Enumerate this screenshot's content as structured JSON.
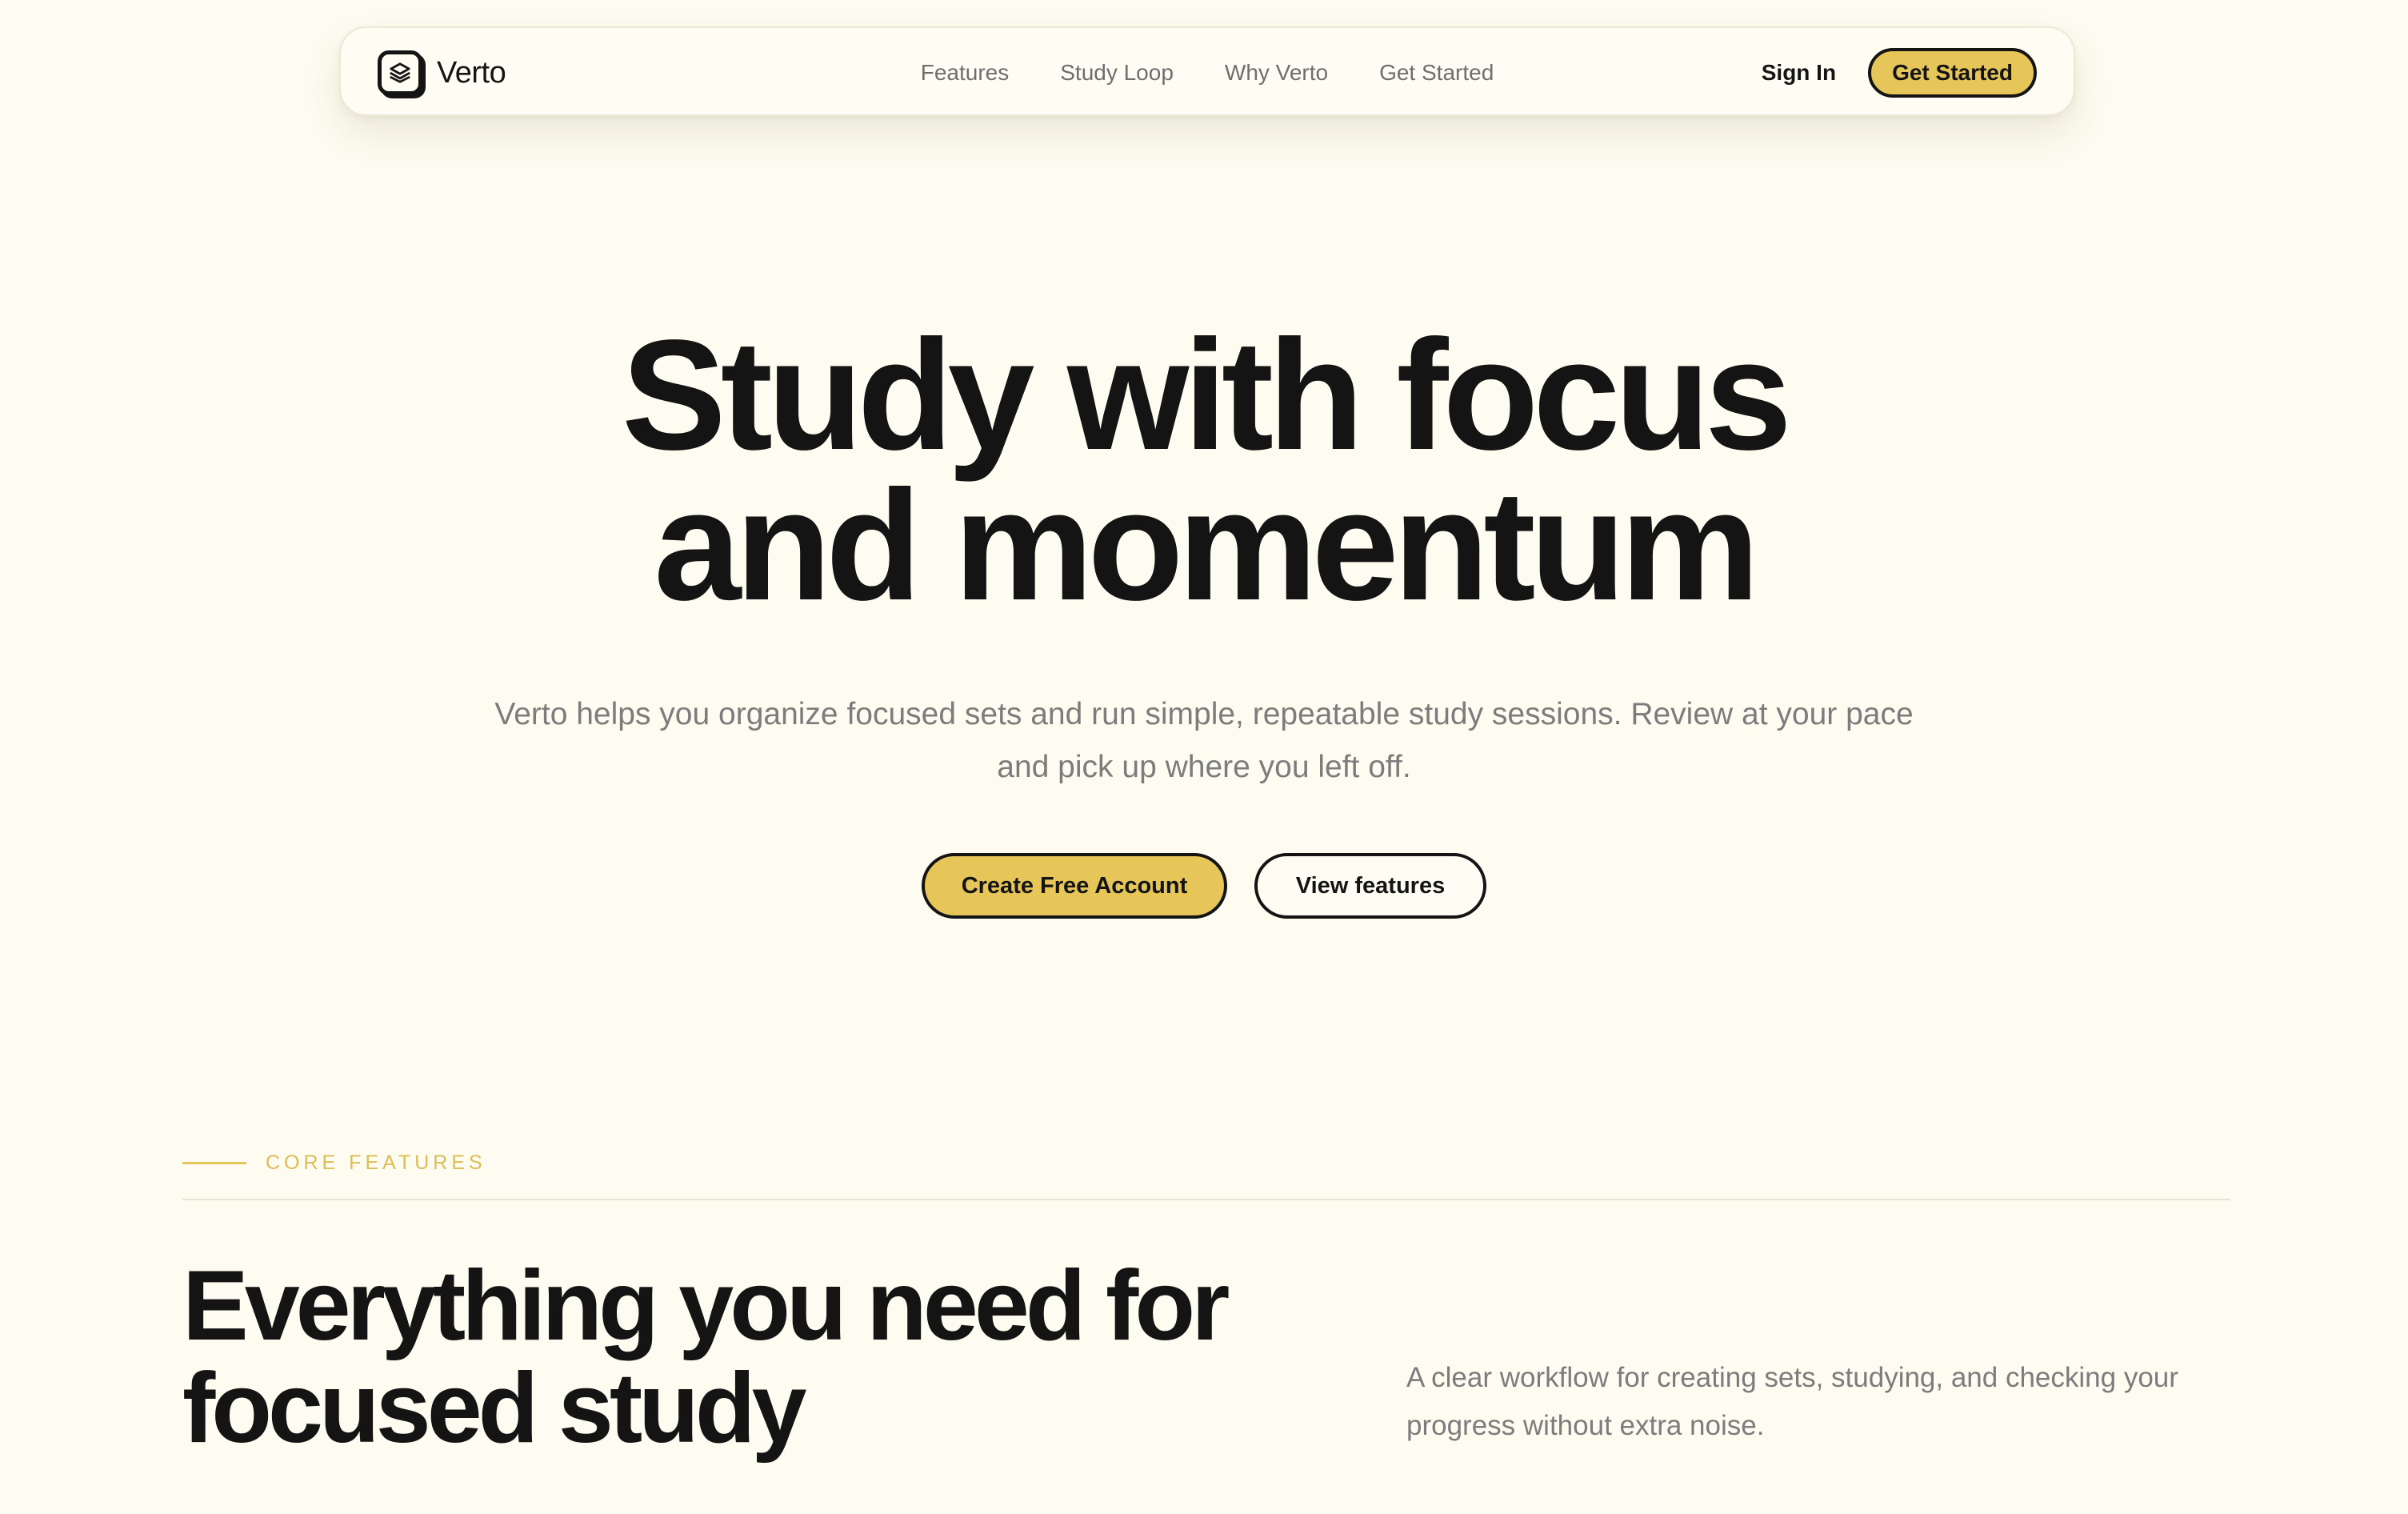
{
  "nav": {
    "brand": "Verto",
    "logo_icon": "layers-icon",
    "links": [
      "Features",
      "Study Loop",
      "Why Verto",
      "Get Started"
    ],
    "sign_in": "Sign In",
    "cta": "Get Started"
  },
  "hero": {
    "title_line1": "Study with focus",
    "title_line2": "and momentum",
    "subtitle": "Verto helps you organize focused sets and run simple, repeatable study sessions. Review at your pace and pick up where you left off.",
    "primary_cta": "Create Free Account",
    "secondary_cta": "View features"
  },
  "features": {
    "eyebrow": "CORE FEATURES",
    "title_line1": "Everything you need for",
    "title_line2": "focused study",
    "description": "A clear workflow for creating sets, studying, and checking your progress without extra noise."
  },
  "colors": {
    "background": "#fefcf0",
    "accent": "#e6c658",
    "eyebrow": "#dcbd55",
    "text": "#141414",
    "muted": "#7c7c7c"
  }
}
